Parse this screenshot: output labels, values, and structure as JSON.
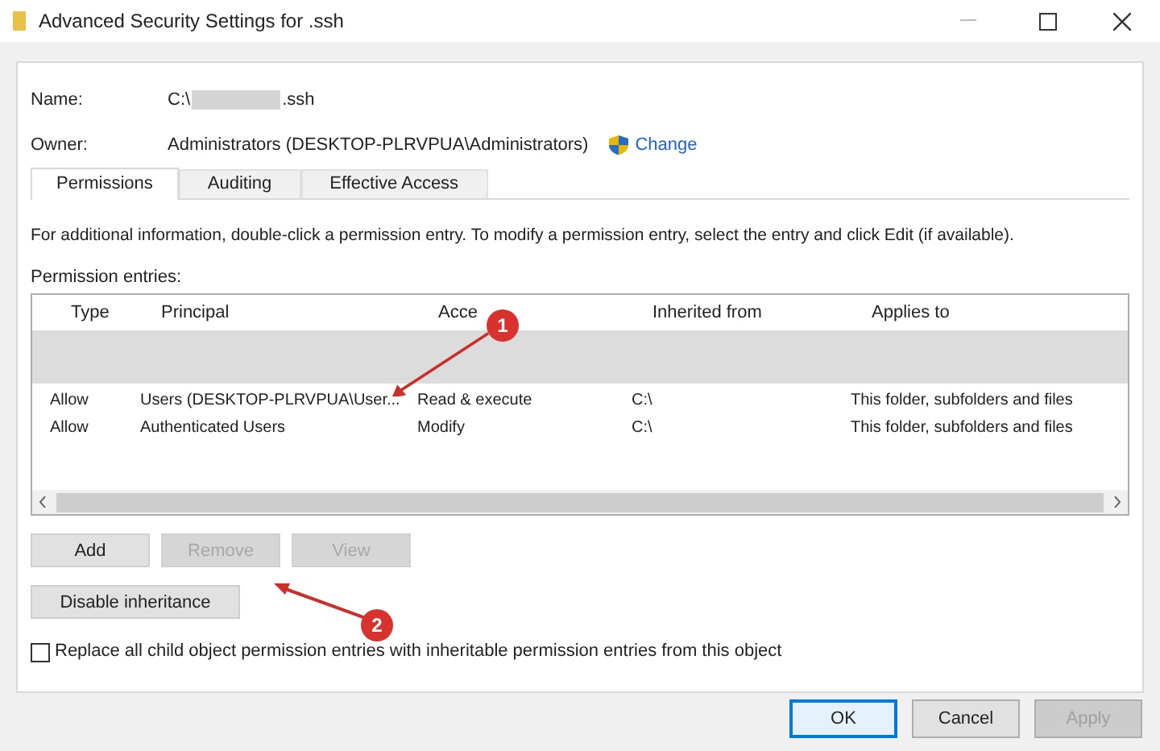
{
  "window": {
    "title": "Advanced Security Settings for .ssh"
  },
  "name": {
    "label": "Name:",
    "prefix": "C:\\",
    "suffix": ".ssh"
  },
  "owner": {
    "label": "Owner:",
    "value": "Administrators (DESKTOP-PLRVPUA\\Administrators)",
    "link": "Change"
  },
  "tabs": [
    {
      "label": "Permissions",
      "selected": true
    },
    {
      "label": "Auditing",
      "selected": false
    },
    {
      "label": "Effective Access",
      "selected": false
    }
  ],
  "info": "For additional information, double-click a permission entry. To modify a permission entry, select the entry and click Edit (if available).",
  "entries_label": "Permission entries:",
  "table": {
    "columns": [
      "Type",
      "Principal",
      "Acce",
      "Inherited from",
      "Applies to"
    ],
    "rows": [
      {
        "kind": "redacted",
        "selected": true
      },
      {
        "kind": "entry",
        "selected": false,
        "cells": [
          "Allow",
          "Users (DESKTOP-PLRVPUA\\User...",
          "Read & execute",
          "C:\\",
          "This folder, subfolders and files"
        ]
      },
      {
        "kind": "entry",
        "selected": false,
        "cells": [
          "Allow",
          "Authenticated Users",
          "Modify",
          "C:\\",
          "This folder, subfolders and files"
        ]
      }
    ]
  },
  "buttons": [
    {
      "label": "Add",
      "disabled": false
    },
    {
      "label": "Remove",
      "disabled": true
    },
    {
      "label": "View",
      "disabled": true
    }
  ],
  "disable_inheritance": {
    "label": "Disable inheritance"
  },
  "replace_checkbox": {
    "label": "Replace all child object permission entries with inheritable permission entries from this object",
    "checked": false
  },
  "annotations": [
    "1",
    "2"
  ],
  "footer_buttons": [
    {
      "label": "OK",
      "disabled": false,
      "default": true
    },
    {
      "label": "Cancel",
      "disabled": false,
      "default": false
    },
    {
      "label": "Apply",
      "disabled": true,
      "default": false
    }
  ]
}
